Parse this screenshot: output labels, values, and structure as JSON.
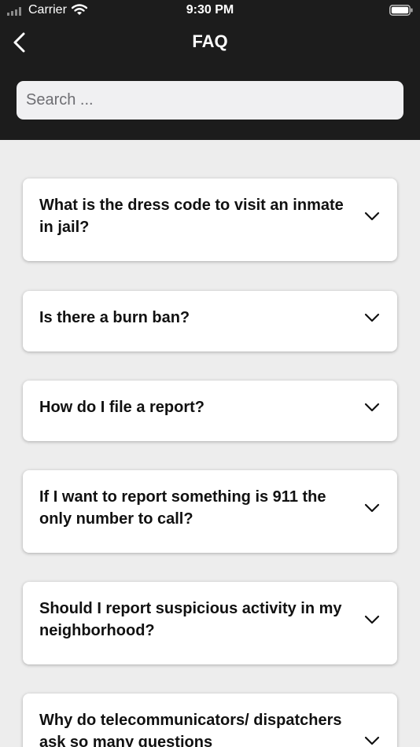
{
  "status_bar": {
    "carrier": "Carrier",
    "time": "9:30 PM",
    "icons": [
      "signal-icon",
      "wifi-icon",
      "battery-icon"
    ]
  },
  "nav": {
    "title": "FAQ",
    "back_icon": "chevron-left-icon"
  },
  "search": {
    "placeholder": "Search ...",
    "value": ""
  },
  "faq": {
    "items": [
      {
        "question": "What is the dress code to visit an inmate in jail?"
      },
      {
        "question": "Is there a burn ban?"
      },
      {
        "question": "How do I file a report?"
      },
      {
        "question": "If I want to report something is 911 the only number to call?"
      },
      {
        "question": "Should I report suspicious activity in my neighborhood?"
      },
      {
        "question": "Why do telecommunicators/ dispatchers ask so many questions"
      }
    ],
    "expand_icon": "chevron-down-icon"
  },
  "colors": {
    "header_bg": "#1c1c1c",
    "page_bg": "#ededed",
    "card_bg": "#ffffff",
    "search_bg": "#f0f0f2"
  }
}
